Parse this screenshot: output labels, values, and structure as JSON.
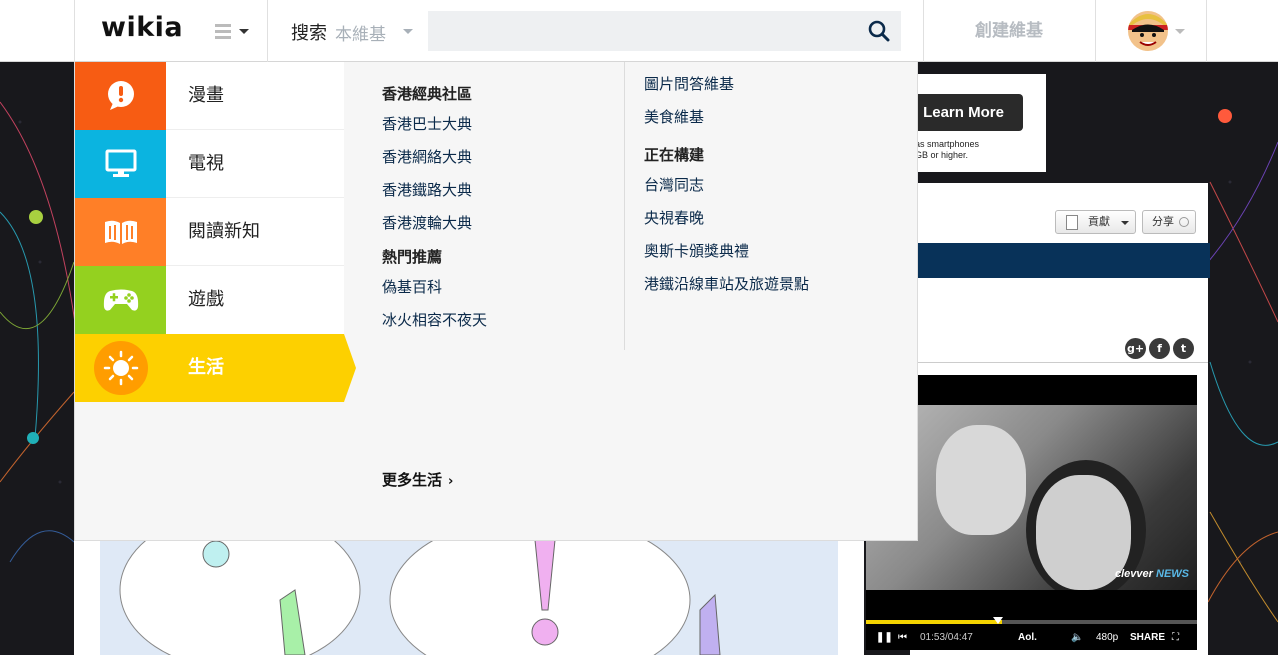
{
  "nav": {
    "logo": "wikia",
    "search_label": "搜索",
    "search_scope": "本維基",
    "search_placeholder": "",
    "create_wiki": "創建維基"
  },
  "verticals": [
    {
      "label": "漫畫",
      "color": "#f75c13",
      "icon": "speech-bubble-exclamation-icon"
    },
    {
      "label": "電視",
      "color": "#0bb4e0",
      "icon": "monitor-icon"
    },
    {
      "label": "閱讀新知",
      "color": "#ff7f27",
      "icon": "open-book-icon"
    },
    {
      "label": "遊戲",
      "color": "#94d11f",
      "icon": "gamepad-icon"
    },
    {
      "label": "生活",
      "color": "#fdd000",
      "icon": "sun-icon",
      "active": true
    }
  ],
  "menu": {
    "col1": [
      {
        "title": "香港經典社區",
        "links": [
          "香港巴士大典",
          "香港網絡大典",
          "香港鐵路大典",
          "香港渡輪大典"
        ]
      },
      {
        "title": "熱門推薦",
        "links": [
          "偽基百科",
          "冰火相容不夜天"
        ]
      }
    ],
    "col2": [
      {
        "title": "",
        "links": [
          "圖片問答維基",
          "美食維基"
        ]
      },
      {
        "title": "正在構建",
        "links": [
          "台灣同志",
          "央視春晚",
          "奧斯卡頒獎典禮",
          "港鐵沿線車站及旅遊景點"
        ]
      }
    ],
    "more": "更多生活"
  },
  "page": {
    "ad_button": "Learn More",
    "ad_text_1": "as smartphones",
    "ad_text_2": "GB or higher.",
    "contribute": "貢獻",
    "share": "分享",
    "video": {
      "time": "01:53/04:47",
      "quality": "480p",
      "share": "SHARE",
      "brand": "Aol.",
      "channel": "clevver",
      "channel_tag": "NEWS",
      "progress": 0.41
    }
  }
}
